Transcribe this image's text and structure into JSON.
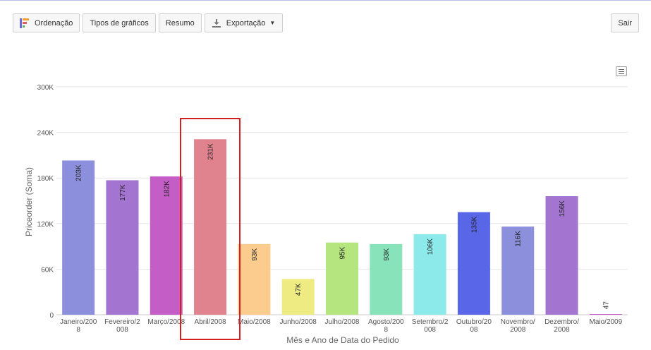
{
  "toolbar": {
    "sort_label": "Ordenação",
    "chart_types_label": "Tipos de gráficos",
    "summary_label": "Resumo",
    "export_label": "Exportação",
    "exit_label": "Sair"
  },
  "colors": {
    "highlight": "#d21f1f",
    "grid": "#e6e6e6",
    "axis_text": "#555555"
  },
  "chart_data": {
    "type": "bar",
    "title": "",
    "xlabel": "Mês e Ano de Data do Pedido",
    "ylabel": "Priceorder (Soma)",
    "ylim": [
      0,
      300000
    ],
    "yticks": [
      0,
      60000,
      120000,
      180000,
      240000,
      300000
    ],
    "ytick_labels": [
      "0",
      "60K",
      "120K",
      "180K",
      "240K",
      "300K"
    ],
    "grid": true,
    "legend": "none",
    "categories": [
      [
        "Janeiro/200",
        "8"
      ],
      [
        "Fevereiro/2",
        "008"
      ],
      [
        "Março/2008"
      ],
      [
        "Abril/2008"
      ],
      [
        "Maio/2008"
      ],
      [
        "Junho/2008"
      ],
      [
        "Julho/2008"
      ],
      [
        "Agosto/200",
        "8"
      ],
      [
        "Setembro/2",
        "008"
      ],
      [
        "Outubro/20",
        "08"
      ],
      [
        "Novembro/",
        "2008"
      ],
      [
        "Dezembro/",
        "2008"
      ],
      [
        "Maio/2009"
      ]
    ],
    "values": [
      203000,
      177000,
      182000,
      231000,
      93000,
      47000,
      95000,
      93000,
      106000,
      135000,
      116000,
      156000,
      47
    ],
    "data_labels": [
      "203K",
      "177K",
      "182K",
      "231K",
      "93K",
      "47K",
      "95K",
      "93K",
      "106K",
      "135K",
      "116K",
      "156K",
      "47"
    ],
    "bar_colors": [
      "#8c8fdb",
      "#a374d0",
      "#c45ec6",
      "#e0838f",
      "#fbcc8e",
      "#eeeb83",
      "#b4e57f",
      "#88e3bb",
      "#8ceaea",
      "#5a66e8",
      "#8c8fdb",
      "#a374d0",
      "#c45ec6"
    ],
    "highlighted_category_index": 3
  }
}
